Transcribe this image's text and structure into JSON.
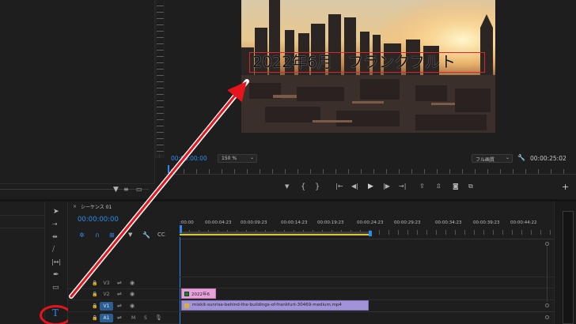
{
  "source_panel": {
    "scroll_icon": "wrench-scroll-icon"
  },
  "program_monitor": {
    "video_overlay_text": "2022年6月　フランクフルト",
    "timecode_current": "00:00:00:00",
    "zoom_level": "150 %",
    "quality": "フル画質",
    "timecode_duration": "00:00:25:02"
  },
  "transport": {
    "buttons": [
      "marker-icon",
      "in-point-icon",
      "out-point-icon",
      "go-to-in-icon",
      "step-back-icon",
      "play-icon",
      "step-forward-icon",
      "go-to-out-icon",
      "lift-icon",
      "extract-icon",
      "export-frame-icon",
      "comparison-view-icon"
    ],
    "add_button": "+"
  },
  "tools": [
    "selection-tool-icon",
    "track-select-tool-icon",
    "ripple-edit-tool-icon",
    "razor-tool-icon",
    "slip-tool-icon",
    "pen-tool-icon",
    "rectangle-tool-icon",
    "type-tool-icon"
  ],
  "timeline": {
    "sequence_name": "シーケンス 01",
    "timecode": "00:00:00:00",
    "ruler": [
      ":00:00",
      "00:00:04:23",
      "00:00:09:23",
      "00:00:14:23",
      "00:00:19:23",
      "00:00:24:23",
      "00:00:29:23",
      "00:00:34:23",
      "00:00:39:23",
      "00:00:44:22"
    ],
    "tracks": [
      {
        "name": "V3",
        "type": "video"
      },
      {
        "name": "V2",
        "type": "video"
      },
      {
        "name": "V1",
        "type": "video",
        "active": true
      },
      {
        "name": "A1",
        "type": "audio",
        "active": true,
        "m": "M",
        "s": "S"
      }
    ],
    "clips": {
      "graphic_label": "2022年6",
      "video_label": "mixkit-sunrise-behind-the-buildings-of-frankfurt-30469-medium.mp4"
    }
  },
  "colors": {
    "accent_blue": "#2d8ceb",
    "annotation_red": "#e8141c",
    "graphic_clip": "#e9a1dd",
    "video_clip": "#a293d8",
    "work_area": "#d8c630"
  }
}
